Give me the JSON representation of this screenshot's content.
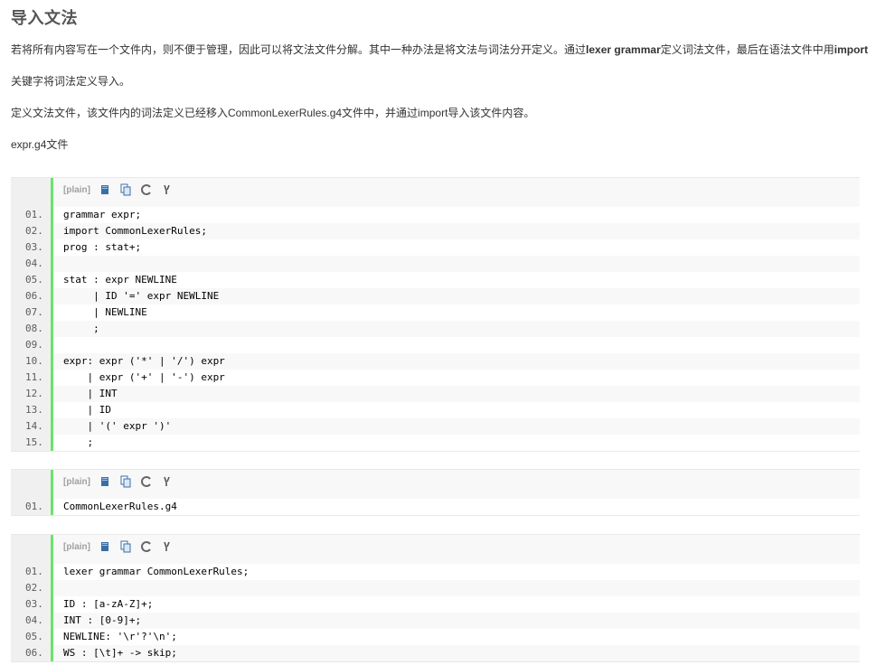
{
  "title": "导入文法",
  "paragraphs": {
    "p1_a": "若将所有内容写在一个文件内，则不便于管理，因此可以将文法文件分解。其中一种办法是将文法与词法分开定义。通过",
    "p1_b": "lexer grammar",
    "p1_c": "定义词法文件，最后在语法文件中用",
    "p1_d": "import",
    "p2": "关键字将词法定义导入。",
    "p3": "定义文法文件，该文件内的词法定义已经移入CommonLexerRules.g4文件中，并通过import导入该文件内容。",
    "p4": "expr.g4文件"
  },
  "toolbar": {
    "plain_label": "[plain]",
    "icons": [
      "view-source-icon",
      "copy-icon",
      "print-icon",
      "help-icon"
    ]
  },
  "blocks": [
    {
      "lines": [
        {
          "n": "01.",
          "code": "grammar expr;"
        },
        {
          "n": "02.",
          "code": "import CommonLexerRules;"
        },
        {
          "n": "03.",
          "code": "prog : stat+;"
        },
        {
          "n": "04.",
          "code": ""
        },
        {
          "n": "05.",
          "code": "stat : expr NEWLINE"
        },
        {
          "n": "06.",
          "code": "     | ID '=' expr NEWLINE"
        },
        {
          "n": "07.",
          "code": "     | NEWLINE"
        },
        {
          "n": "08.",
          "code": "     ;"
        },
        {
          "n": "09.",
          "code": ""
        },
        {
          "n": "10.",
          "code": "expr: expr ('*' | '/') expr"
        },
        {
          "n": "11.",
          "code": "    | expr ('+' | '-') expr"
        },
        {
          "n": "12.",
          "code": "    | INT"
        },
        {
          "n": "13.",
          "code": "    | ID"
        },
        {
          "n": "14.",
          "code": "    | '(' expr ')'"
        },
        {
          "n": "15.",
          "code": "    ;"
        }
      ]
    },
    {
      "lines": [
        {
          "n": "01.",
          "code": "CommonLexerRules.g4"
        }
      ]
    },
    {
      "lines": [
        {
          "n": "01.",
          "code": "lexer grammar CommonLexerRules;"
        },
        {
          "n": "02.",
          "code": ""
        },
        {
          "n": "03.",
          "code": "ID : [a-zA-Z]+;"
        },
        {
          "n": "04.",
          "code": "INT : [0-9]+;"
        },
        {
          "n": "05.",
          "code": "NEWLINE: '\\r'?'\\n';"
        },
        {
          "n": "06.",
          "code": "WS : [\\t]+ -> skip;"
        }
      ]
    }
  ]
}
